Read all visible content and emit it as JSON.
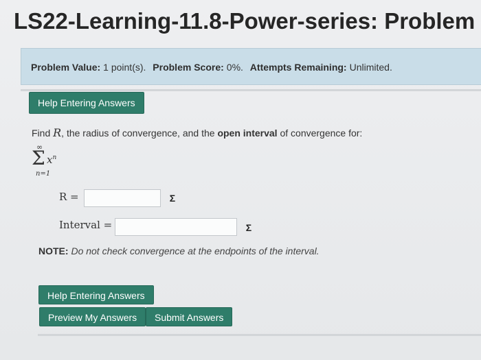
{
  "page": {
    "title": "LS22-Learning-11.8-Power-series: Problem"
  },
  "info_bar": {
    "problem_value_label": "Problem Value:",
    "problem_value": "1 point(s).",
    "problem_score_label": "Problem Score:",
    "problem_score": "0%.",
    "attempts_label": "Attempts Remaining:",
    "attempts": "Unlimited."
  },
  "buttons": {
    "help_top": "Help Entering Answers",
    "help_bottom": "Help Entering Answers",
    "preview": "Preview My Answers",
    "submit": "Submit Answers"
  },
  "problem": {
    "prompt_start": "Find",
    "prompt_var": "R",
    "prompt_mid": ", the radius of convergence, and the",
    "prompt_bold": "open interval",
    "prompt_end": "of convergence for:",
    "sum_upper": "∞",
    "sum_symbol": "Σ",
    "sum_term": "x",
    "sum_term_exp": "n",
    "sum_lower": "n=1"
  },
  "answers": {
    "r_label": "R =",
    "r_value": "",
    "interval_label": "Interval =",
    "interval_value": "",
    "sigma_symbol": "Σ"
  },
  "note": {
    "label": "NOTE:",
    "text": "Do not check convergence at the endpoints of the interval."
  }
}
